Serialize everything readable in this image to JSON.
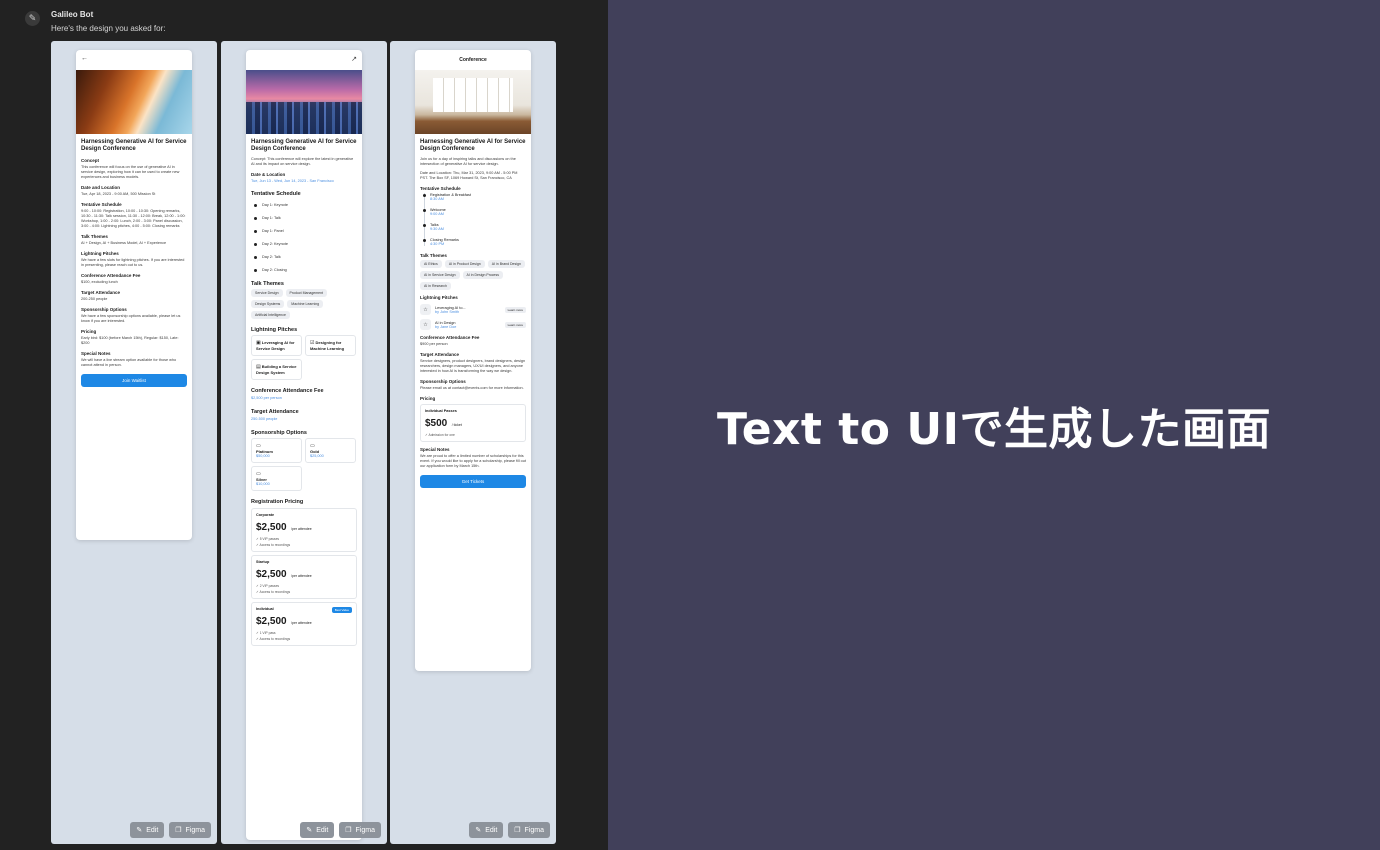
{
  "chat": {
    "bot_name": "Galileo Bot",
    "message": "Here's the design you asked for:"
  },
  "tools": {
    "edit": "Edit",
    "figma": "Figma"
  },
  "design1": {
    "title": "Harnessing Generative AI for Service Design Conference",
    "concept_h": "Concept",
    "concept": "This conference will focus on the use of generative AI in service design, exploring how it can be used to create new experiences and business models.",
    "date_h": "Date and Location",
    "date": "Tue, Apr 18, 2023 - 9:00 AM, 500 Mission St",
    "schedule_h": "Tentative Schedule",
    "schedule": "9:00 - 10:00: Registration, 10:00 - 10:30: Opening remarks, 10:30 - 11:30: Talk session, 11:30 - 12:00: Break, 12:00 - 1:00: Workshop, 1:00 - 2:00: Lunch, 2:00 - 3:00: Panel discussion, 3:00 - 4:00: Lightning pitches, 4:00 - 5:00: Closing remarks",
    "themes_h": "Talk Themes",
    "themes": "AI + Design, AI + Business Model, AI + Experience",
    "pitches_h": "Lightning Pitches",
    "pitches": "We have a few slots for lightning pitches. If you are interested in presenting, please reach out to us.",
    "fee_h": "Conference Attendance Fee",
    "fee": "$100, excluding lunch",
    "target_h": "Target Attendance",
    "target": "200-250 people",
    "sponsor_h": "Sponsorship Options",
    "sponsor": "We have a few sponsorship options available, please let us know if you are interested.",
    "pricing_h": "Pricing",
    "pricing": "Early bird: $100 (before March 15th), Regular: $150, Late: $200",
    "notes_h": "Special Notes",
    "notes": "We will have a live stream option available for those who cannot attend in person.",
    "cta": "Join Waitlist"
  },
  "design2": {
    "title": "Harnessing Generative AI for Service Design Conference",
    "concept": "Concept: This conference will explore the latest in generative AI and its impact on service design.",
    "date_h": "Date & Location",
    "date": "Tue, Jun 13 - Wed, Jun 14, 2023 - San Francisco",
    "schedule_h": "Tentative Schedule",
    "schedule": [
      "Day 1: Keynote",
      "Day 1: Talk",
      "Day 1: Panel",
      "Day 2: Keynote",
      "Day 2: Talk",
      "Day 2: Closing"
    ],
    "themes_h": "Talk Themes",
    "themes": [
      "Service Design",
      "Product Management",
      "Design Systems",
      "Machine Learning",
      "Artificial Intelligence"
    ],
    "pitches_h": "Lightning Pitches",
    "pitches": [
      "Leveraging AI for Service Design",
      "Designing for Machine Learning",
      "Building a Service Design System"
    ],
    "fee_h": "Conference Attendance Fee",
    "fee": "$2,500 per person",
    "target_h": "Target Attendance",
    "target": "250-500 people",
    "sponsor_h": "Sponsorship Options",
    "sponsors": [
      {
        "name": "Platinum",
        "price": "$50,000"
      },
      {
        "name": "Gold",
        "price": "$25,000"
      },
      {
        "name": "Silver",
        "price": "$10,000"
      }
    ],
    "reg_h": "Registration Pricing",
    "plans": [
      {
        "name": "Corporate",
        "amount": "$2,500",
        "per": "/per attendee",
        "f1": "5 VIP passes",
        "f2": "Access to recordings",
        "badge": ""
      },
      {
        "name": "Startup",
        "amount": "$2,500",
        "per": "/per attendee",
        "f1": "2 VIP passes",
        "f2": "Access to recordings",
        "badge": ""
      },
      {
        "name": "Individual",
        "amount": "$2,500",
        "per": "/per attendee",
        "f1": "1 VIP pass",
        "f2": "Access to recordings",
        "badge": "Best Value"
      }
    ]
  },
  "design3": {
    "top_title": "Conference",
    "title": "Harnessing Generative AI for Service Design Conference",
    "intro": "Join us for a day of inspiring talks and discussions on the intersection of generative AI for service design.",
    "date": "Date and Location: Thu, Mar 31, 2023, 9:00 AM - 5:00 PM PST. The Box SF, 1069 Howard St, San Francisco, CA",
    "schedule_h": "Tentative Schedule",
    "timeline": [
      {
        "label": "Registration & Breakfast",
        "time": "8:30 AM"
      },
      {
        "label": "Welcome",
        "time": "9:00 AM"
      },
      {
        "label": "Talks",
        "time": "9:30 AM"
      },
      {
        "label": "Closing Remarks",
        "time": "4:30 PM"
      }
    ],
    "themes_h": "Talk Themes",
    "themes": [
      "AI Ethics",
      "AI in Product Design",
      "AI in Brand Design",
      "AI in Service Design",
      "AI in Design Process",
      "AI in Research"
    ],
    "pitches_h": "Lightning Pitches",
    "pitches": [
      {
        "title": "Leveraging AI to...",
        "by": "by John Smith",
        "action": "Learn more"
      },
      {
        "title": "AI in Design",
        "by": "by Jane Doe",
        "action": "Learn more"
      }
    ],
    "fee_h": "Conference Attendance Fee",
    "fee": "$900 per person",
    "target_h": "Target Attendance",
    "target": "Service designers, product designers, brand designers, design researchers, design managers, UX/UI designers, and anyone interested in how AI is transforming the way we design.",
    "sponsor_h": "Sponsorship Options",
    "sponsor": "Please email us at contact@events.com for more information.",
    "pricing_h": "Pricing",
    "pass_name": "Individual Passes",
    "pass_amount": "$500",
    "pass_per": "/ ticket",
    "pass_feat": "Admission for one",
    "notes_h": "Special Notes",
    "notes": "We are proud to offer a limited number of scholarships for this event. If you would like to apply for a scholarship, please fill out our application form by March 15th.",
    "cta": "Get Tickets"
  },
  "right_caption": "Text to UIで生成した画面"
}
